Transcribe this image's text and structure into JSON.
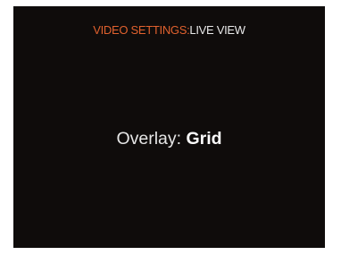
{
  "header": {
    "category": "VIDEO SETTINGS:",
    "page": "LIVE VIEW"
  },
  "setting": {
    "label": "Overlay:",
    "value": "Grid"
  },
  "colors": {
    "background": "#0f0c0b",
    "accent": "#e0612e",
    "text": "#e6e6e6"
  }
}
